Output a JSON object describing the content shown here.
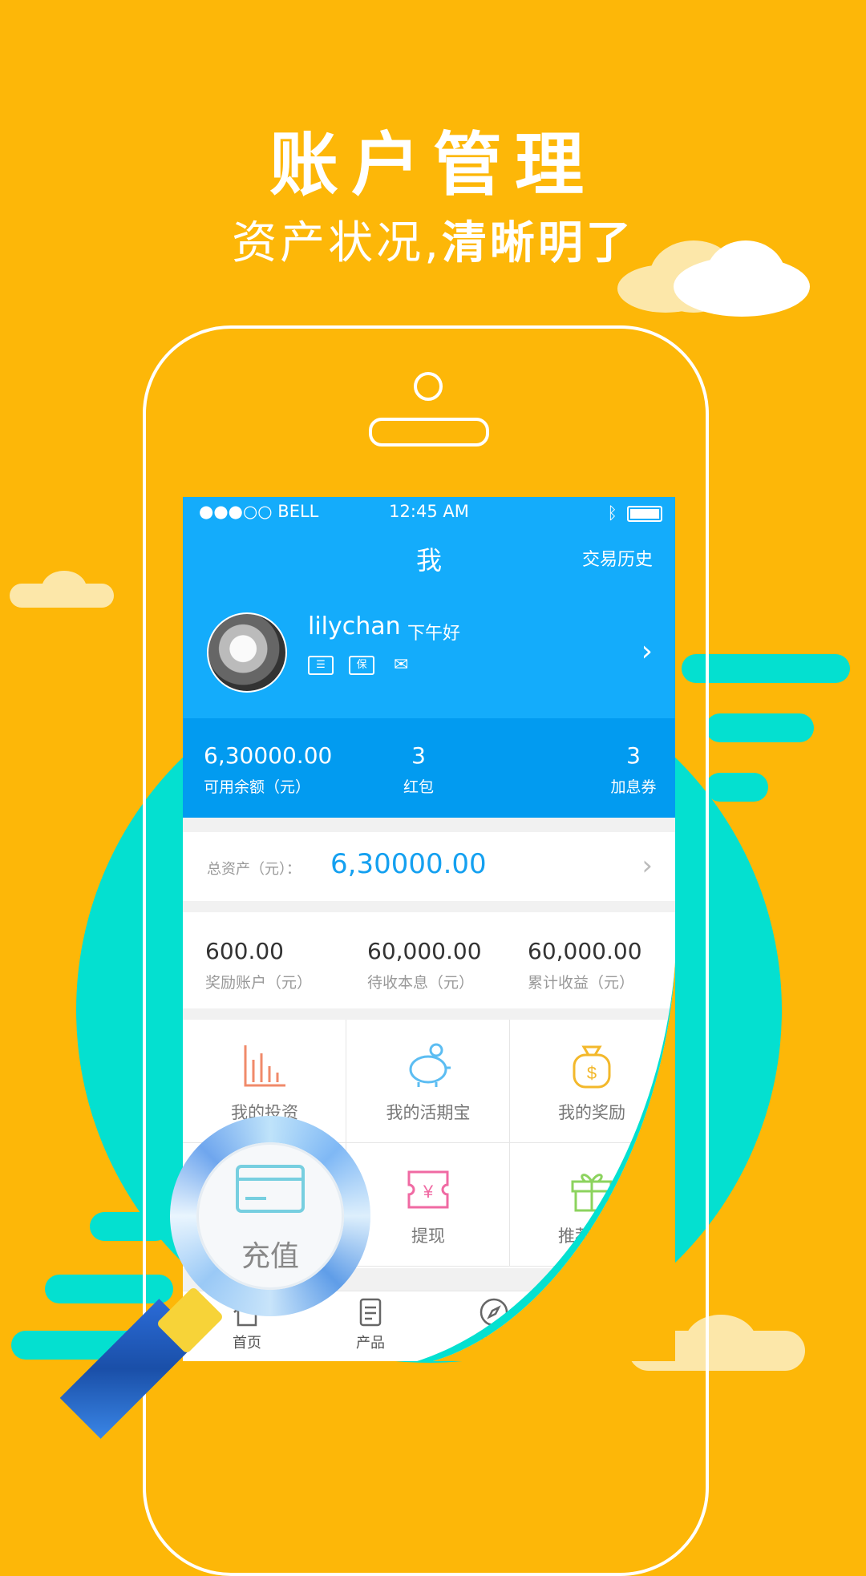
{
  "headline": {
    "title": "账户管理",
    "subtitle_plain": "资产状况,",
    "subtitle_bold": "清晰明了"
  },
  "colors": {
    "background": "#FDB708",
    "teal": "#04E0D0",
    "app_blue": "#14ACFB",
    "balance_blue": "#029BF0",
    "accent_text": "#14A0F0"
  },
  "status_bar": {
    "carrier": "●●●○○ BELL",
    "time": "12:45 AM"
  },
  "header": {
    "title": "我",
    "history_label": "交易历史"
  },
  "profile": {
    "username": "lilychan",
    "greeting": "下午好",
    "badges": [
      "实名认证",
      "保",
      "邮箱"
    ],
    "badge_glyphs": [
      "☰",
      "保",
      "✉"
    ]
  },
  "balances": [
    {
      "value": "6,30000.00",
      "label": "可用余额（元）"
    },
    {
      "value": "3",
      "label": "红包"
    },
    {
      "value": "3",
      "label": "加息券"
    }
  ],
  "total_assets": {
    "label": "总资产（元）：",
    "value": "6,30000.00"
  },
  "stats": [
    {
      "value": "600.00",
      "label": "奖励账户（元）"
    },
    {
      "value": "60,000.00",
      "label": "待收本息（元）"
    },
    {
      "value": "60,000.00",
      "label": "累计收益（元）"
    }
  ],
  "features": [
    {
      "label": "我的投资",
      "icon": "bar-chart-icon"
    },
    {
      "label": "我的活期宝",
      "icon": "piggy-bank-icon"
    },
    {
      "label": "我的奖励",
      "icon": "money-bag-icon"
    },
    {
      "label": "充值",
      "icon": "card-icon"
    },
    {
      "label": "提现",
      "icon": "withdraw-ticket-icon"
    },
    {
      "label": "推荐有奖",
      "icon": "gift-icon"
    }
  ],
  "tabs": [
    {
      "label": "首页",
      "icon": "home-icon"
    },
    {
      "label": "产品",
      "icon": "document-icon"
    },
    {
      "label": "发现",
      "icon": "compass-icon"
    }
  ],
  "magnifier": {
    "label": "充值"
  }
}
